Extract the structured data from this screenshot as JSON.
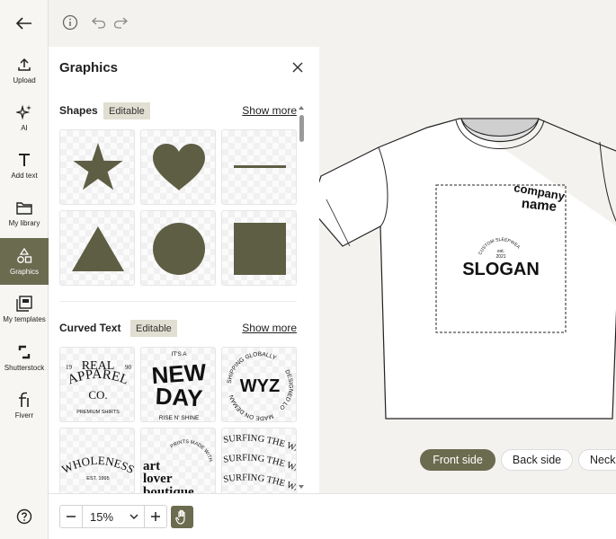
{
  "rail": {
    "items": [
      {
        "label": "Upload",
        "icon": "upload-icon"
      },
      {
        "label": "AI",
        "icon": "sparkle-icon"
      },
      {
        "label": "Add text",
        "icon": "text-icon"
      },
      {
        "label": "My library",
        "icon": "folder-icon"
      },
      {
        "label": "Graphics",
        "icon": "shapes-icon"
      },
      {
        "label": "My templates",
        "icon": "templates-icon"
      },
      {
        "label": "Shutterstock",
        "icon": "shutterstock-icon"
      },
      {
        "label": "Fiverr",
        "icon": "fiverr-icon"
      }
    ],
    "active": "Graphics"
  },
  "panel": {
    "title": "Graphics",
    "sections": [
      {
        "title": "Shapes",
        "badge": "Editable",
        "show_more": "Show more"
      },
      {
        "title": "Curved Text",
        "badge": "Editable",
        "show_more": "Show more"
      }
    ]
  },
  "shapes": [
    "star",
    "heart",
    "line",
    "triangle",
    "circle",
    "square"
  ],
  "curved_text": {
    "real_apparel": {
      "line1": "REAL",
      "line2": "APPAREL",
      "line3": "CO.",
      "left_num": "19",
      "right_num": "90",
      "sub": "PREMIUM SHIRTS"
    },
    "new_day": {
      "top": "IT'S A",
      "line1": "NEW",
      "line2": "DAY",
      "bottom": "RISE N' SHINE"
    },
    "wyz": {
      "center": "WYZ",
      "ring_top": "SHIPPING GLOBALLY",
      "ring_right": "DESIGNED LOCALLY",
      "ring_bottom": "MADE ON DEMAND"
    },
    "wholeness": {
      "line1": "WHOLENESS",
      "sub": "EST. 1995"
    },
    "art_lover": {
      "arc": "PRINTS MADE WITH LOVE",
      "line1": "art",
      "line2": "lover",
      "line3": "boutique"
    },
    "surfing": {
      "line": "SURFING THE WAVE"
    }
  },
  "design": {
    "company": "company",
    "name": "name",
    "badge_top": "CUSTOM SLEEPWEAR",
    "badge_est": "est.",
    "badge_year": "2021",
    "slogan": "SLOGAN"
  },
  "sides": {
    "front": "Front side",
    "back": "Back side",
    "neck": "Neck"
  },
  "zoom": {
    "value": "15%"
  },
  "colors": {
    "accent": "#6b6b4f",
    "shape_fill": "#5e5e45",
    "badge_bg": "#e0dfd2"
  }
}
